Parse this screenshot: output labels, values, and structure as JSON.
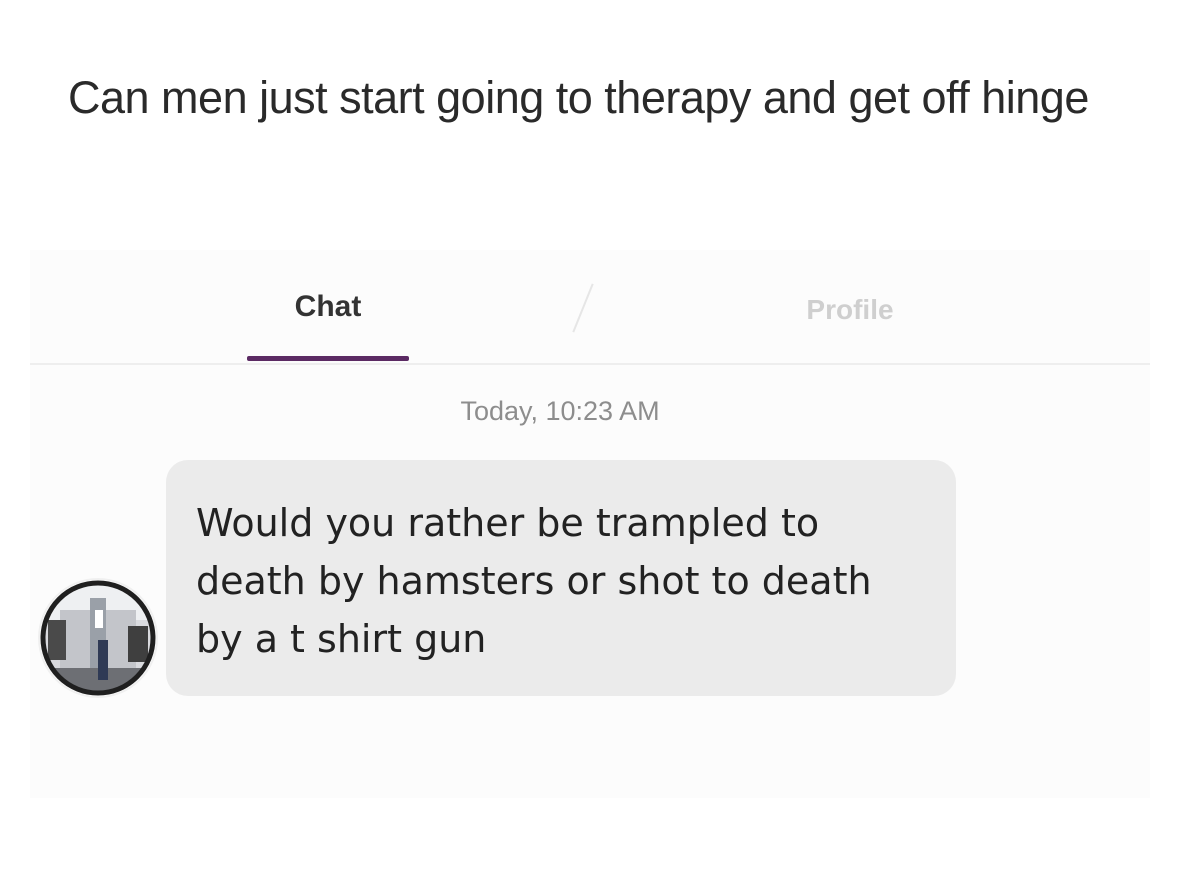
{
  "caption": "Can men just start going to therapy and get off hinge",
  "tabs": {
    "chat": "Chat",
    "profile": "Profile"
  },
  "chat": {
    "timestamp": "Today, 10:23 AM",
    "message": "Would you rather be trampled to death by hamsters or shot to death by a t shirt gun"
  },
  "colors": {
    "accent": "#5b2a63",
    "bubble": "#ebebeb"
  }
}
